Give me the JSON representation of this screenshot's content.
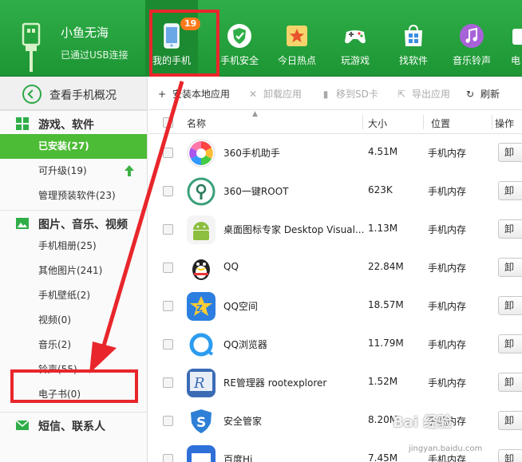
{
  "device": {
    "name": "小鱼无海",
    "status": "已通过USB连接"
  },
  "nav": {
    "tabs": [
      {
        "label": "我的手机",
        "icon": "phone-icon",
        "active": true,
        "badge": "19"
      },
      {
        "label": "手机安全",
        "icon": "shield-icon",
        "active": false
      },
      {
        "label": "今日热点",
        "icon": "star-icon",
        "active": false
      },
      {
        "label": "玩游戏",
        "icon": "gamepad-icon",
        "active": false
      },
      {
        "label": "找软件",
        "icon": "store-bag-icon",
        "active": false
      },
      {
        "label": "音乐铃声",
        "icon": "music-note-icon",
        "active": false
      },
      {
        "label": "电",
        "icon": "video-icon",
        "active": false
      }
    ]
  },
  "sidebar": {
    "overview": "查看手机概况",
    "groups": [
      {
        "label": "游戏、软件",
        "icon": "apps-grid-icon",
        "items": [
          {
            "label": "已安装(27)",
            "active": true
          },
          {
            "label": "可升级(19)",
            "active": false
          },
          {
            "label": "管理预装软件(23)",
            "active": false
          }
        ]
      },
      {
        "label": "图片、音乐、视频",
        "icon": "image-icon",
        "items": [
          {
            "label": "手机相册(25)",
            "active": false
          },
          {
            "label": "其他图片(241)",
            "active": false
          },
          {
            "label": "手机壁纸(2)",
            "active": false
          },
          {
            "label": "视频(0)",
            "active": false
          },
          {
            "label": "音乐(2)",
            "active": false
          },
          {
            "label": "铃声(55)",
            "active": false
          },
          {
            "label": "电子书(0)",
            "active": false
          }
        ]
      },
      {
        "label": "短信、联系人",
        "icon": "message-icon",
        "items": []
      }
    ]
  },
  "toolbar": {
    "install": "安装本地应用",
    "uninstall": "卸载应用",
    "move_sd": "移到SD卡",
    "export": "导出应用",
    "refresh": "刷新"
  },
  "table": {
    "headers": {
      "name": "名称",
      "size": "大小",
      "location": "位置",
      "action": "操作"
    },
    "rows": [
      {
        "name": "360手机助手",
        "size": "4.51M",
        "location": "手机内存",
        "action": "卸",
        "icon": "360-assistant-icon"
      },
      {
        "name": "360一键ROOT",
        "size": "623K",
        "location": "手机内存",
        "action": "卸",
        "icon": "root-key-icon"
      },
      {
        "name": "桌面图标专家  Desktop Visual...",
        "size": "1.13M",
        "location": "手机内存",
        "action": "卸",
        "icon": "android-icon"
      },
      {
        "name": "QQ",
        "size": "22.84M",
        "location": "手机内存",
        "action": "卸",
        "icon": "qq-penguin-icon"
      },
      {
        "name": "QQ空间",
        "size": "18.57M",
        "location": "手机内存",
        "action": "卸",
        "icon": "qzone-icon"
      },
      {
        "name": "QQ浏览器",
        "size": "11.79M",
        "location": "手机内存",
        "action": "卸",
        "icon": "qq-browser-icon"
      },
      {
        "name": "RE管理器 rootexplorer",
        "size": "1.52M",
        "location": "手机内存",
        "action": "卸",
        "icon": "re-manager-icon"
      },
      {
        "name": "安全管家",
        "size": "8.20M",
        "location": "手机内存",
        "action": "卸",
        "icon": "security-s-icon"
      },
      {
        "name": "百度Hi",
        "size": "7.45M",
        "location": "手机内存",
        "action": "卸",
        "icon": "baidu-hi-icon"
      }
    ]
  },
  "watermark": {
    "text": "Bai 经验",
    "sub": "jingyan.baidu.com"
  },
  "colors": {
    "green": "#2fae48",
    "active_green": "#4cbb35",
    "annotation_red": "#e8262b"
  }
}
